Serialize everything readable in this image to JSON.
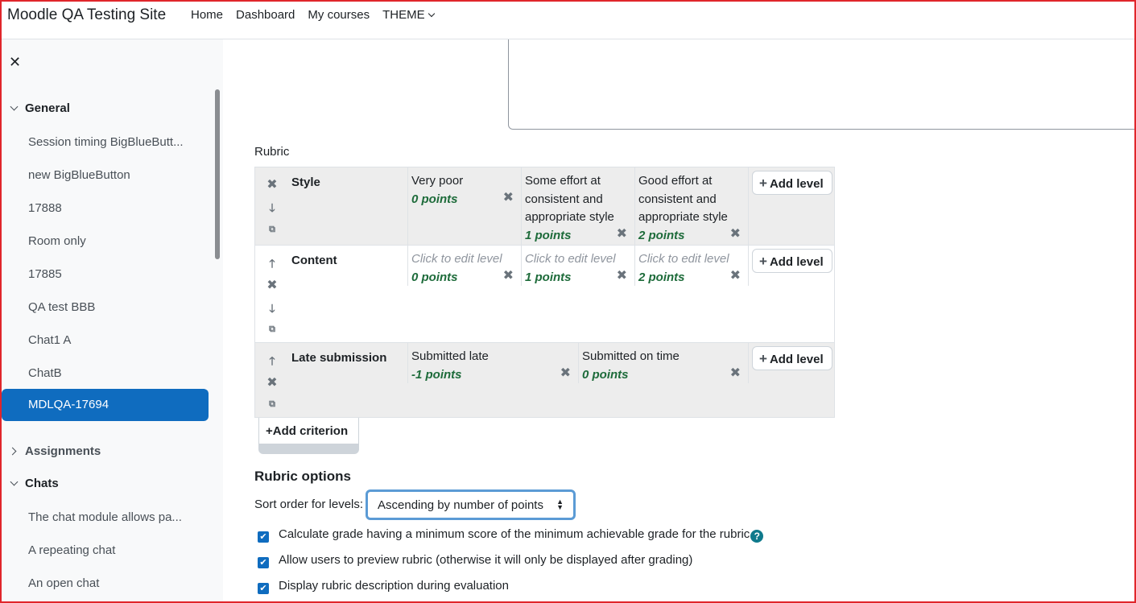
{
  "navbar": {
    "site_name": "Moodle QA Testing Site",
    "links": [
      "Home",
      "Dashboard",
      "My courses",
      "THEME"
    ]
  },
  "drawer": {
    "sections": [
      {
        "title": "General",
        "expanded": true,
        "items": [
          "Session timing BigBlueButt...",
          "new BigBlueButton",
          "17888",
          "Room only",
          "17885",
          "QA test BBB",
          "Chat1 A",
          "ChatB",
          "MDLQA-17694"
        ],
        "active_item": "MDLQA-17694"
      },
      {
        "title": "Assignments",
        "expanded": false,
        "items": []
      },
      {
        "title": "Chats",
        "expanded": true,
        "items": [
          "The chat module allows pa...",
          "A repeating chat",
          "An open chat"
        ]
      }
    ]
  },
  "rubric": {
    "label": "Rubric",
    "criteria": [
      {
        "name": "Style",
        "levels": [
          {
            "definition": "Very poor",
            "points": "0 points"
          },
          {
            "definition": "Some effort at consistent and appropriate style",
            "points": "1 points"
          },
          {
            "definition": "Good effort at consistent and appropriate style",
            "points": "2 points"
          }
        ]
      },
      {
        "name": "Content",
        "levels": [
          {
            "definition": "Click to edit level",
            "points": "0 points"
          },
          {
            "definition": "Click to edit level",
            "points": "1 points"
          },
          {
            "definition": "Click to edit level",
            "points": "2 points"
          }
        ]
      },
      {
        "name": "Late submission",
        "levels": [
          {
            "definition": "Submitted late",
            "points": "-1 points"
          },
          {
            "definition": "Submitted on time",
            "points": "0 points"
          }
        ]
      }
    ],
    "add_level_label": "Add level",
    "add_criterion_label": "Add criterion"
  },
  "options": {
    "heading": "Rubric options",
    "sort_label": "Sort order for levels:",
    "sort_value": "Ascending by number of points",
    "checkboxes": [
      {
        "label": "Calculate grade having a minimum score of the minimum achievable grade for the rubric",
        "checked": true
      },
      {
        "label": "Allow users to preview rubric (otherwise it will only be displayed after grading)",
        "checked": true
      },
      {
        "label": "Display rubric description during evaluation",
        "checked": true
      }
    ]
  },
  "colors": {
    "accent": "#0f6cbf",
    "points": "#1d6b3a",
    "frame": "#e0262b"
  }
}
